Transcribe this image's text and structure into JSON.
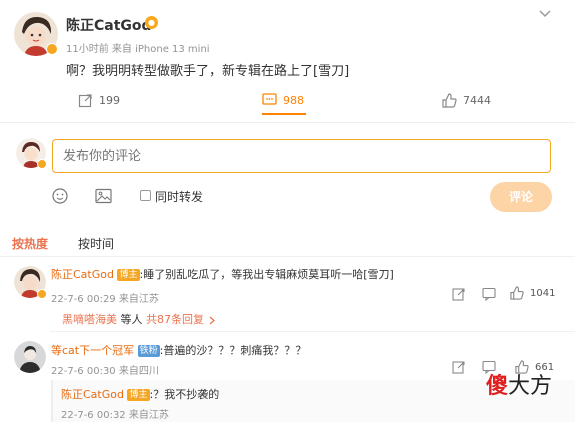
{
  "post": {
    "author": "陈正CatGod",
    "time": "11小时前",
    "source": "来自 iPhone 13 mini",
    "text": "啊？我明明转型做歌手了，新专辑在路上了[雪刀]",
    "repost_count": "199",
    "comment_count": "988",
    "like_count": "7444"
  },
  "compose": {
    "placeholder": "发布你的评论",
    "repost_label": "同时转发",
    "submit_label": "评论"
  },
  "sort": {
    "hot": "按热度",
    "time": "按时间"
  },
  "comments": [
    {
      "author": "陈正CatGod",
      "badge": "博主",
      "text": ":睡了别乱吃瓜了，等我出专辑麻烦莫耳听一哈[雪刀]",
      "meta": "22-7-6 00:29 来自江苏",
      "likes": "1041",
      "replies_by": "黑嘀嗒海美",
      "replies_mid": "等人",
      "replies_count": "共87条回复"
    },
    {
      "author": "等cat下一个冠军",
      "badge": "铁粉",
      "text": ":普遍的沙？？？刺痛我？？？",
      "meta": "22-7-6 00:30 来自四川",
      "likes": "661"
    }
  ],
  "reply": {
    "author": "陈正CatGod",
    "badge": "博主",
    "text": ":？我不抄袭的",
    "meta": "22-7-6 00:32 来自江苏"
  },
  "watermark": {
    "text1": "傻",
    "text2": "大方"
  },
  "colors": {
    "accent": "#ff8200",
    "badge_blogger": "#f5a623",
    "badge_fan": "#5a9ad6",
    "link": "#eb7350"
  }
}
